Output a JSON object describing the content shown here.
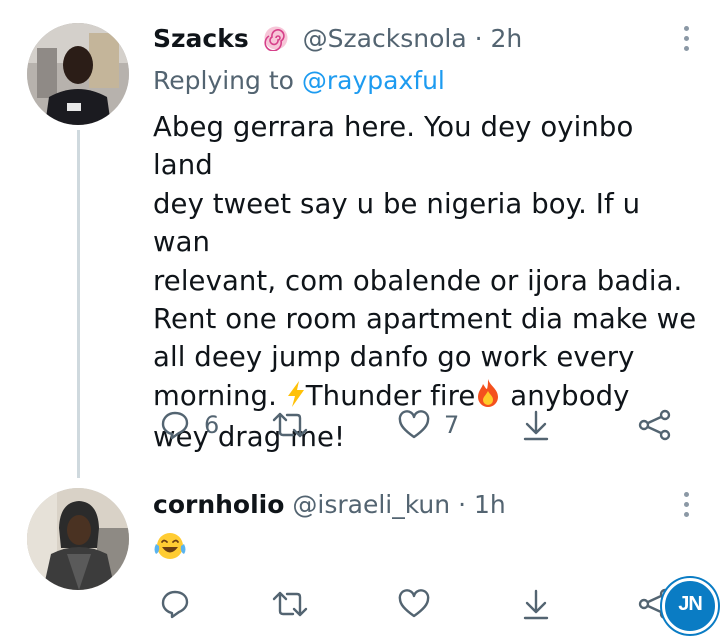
{
  "tweet1": {
    "name": "Szacks",
    "handle": "@Szacksnola",
    "time": "· 2h",
    "replying_label": "Replying to",
    "replying_to": "@raypaxful",
    "text_lines": [
      "Abeg gerrara here. You dey oyinbo land",
      "dey tweet say u be nigeria boy. If u wan",
      "relevant, com obalende or ijora badia.",
      "Rent one room apartment dia make we",
      "all deey jump danfo go work every"
    ],
    "text_line6a": "morning. ",
    "text_line6b": "Thunder fire",
    "text_line6c": " anybody",
    "text_line7": "wey drag me!",
    "reply_count": "6",
    "retweet_count": "",
    "like_count": "7",
    "icons": {
      "badge": "lollipop-emoji-icon",
      "lightning": "high-voltage-emoji-icon",
      "fire": "fire-emoji-icon"
    }
  },
  "tweet2": {
    "name": "cornholio",
    "handle": "@israeli_kun",
    "time": "· 1h",
    "emoji": "face-with-tears-of-joy",
    "reply_count": "",
    "like_count": ""
  },
  "watermark": "JN",
  "colors": {
    "text": "#0f1419",
    "secondary": "#536471",
    "link": "#1d9bf0",
    "thread": "#cfd9de",
    "watermark": "#0a7cc4"
  }
}
